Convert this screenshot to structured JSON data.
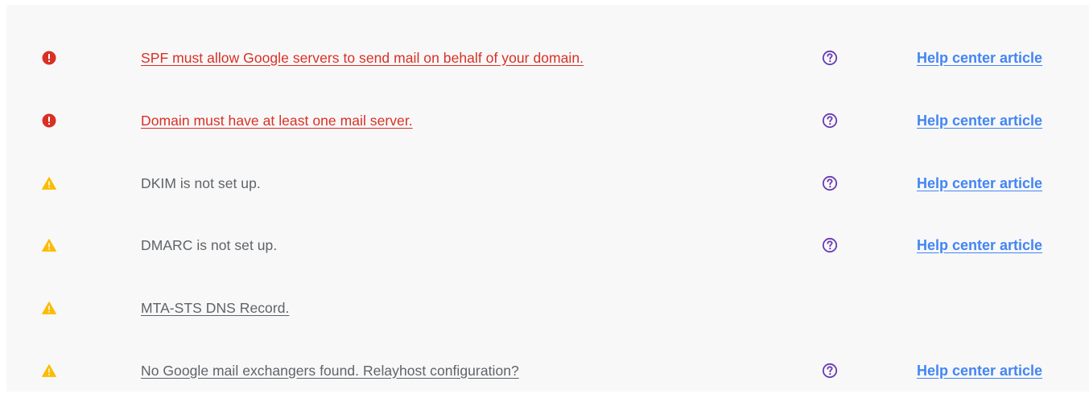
{
  "colors": {
    "error": "#d93025",
    "warning": "#fbbc04",
    "help_icon": "#673ab7",
    "link": "#4285f4",
    "text": "#5f6368"
  },
  "checks": [
    {
      "severity": "error",
      "icon": "error-icon",
      "message": "SPF must allow Google servers to send mail on behalf of your domain.",
      "has_help": true,
      "help_label": "Help center article"
    },
    {
      "severity": "error",
      "icon": "error-icon",
      "message": "Domain must have at least one mail server.",
      "has_help": true,
      "help_label": "Help center article"
    },
    {
      "severity": "warning",
      "icon": "warning-icon",
      "message": "DKIM is not set up.",
      "has_help": true,
      "help_label": "Help center article"
    },
    {
      "severity": "warning",
      "icon": "warning-icon",
      "message": "DMARC is not set up.",
      "has_help": true,
      "help_label": "Help center article"
    },
    {
      "severity": "warning",
      "icon": "warning-icon",
      "message": "MTA-STS DNS Record.",
      "has_help": false
    },
    {
      "severity": "warning",
      "icon": "warning-icon",
      "message": "No Google mail exchangers found. Relayhost configuration?",
      "has_help": true,
      "help_label": "Help center article"
    }
  ]
}
